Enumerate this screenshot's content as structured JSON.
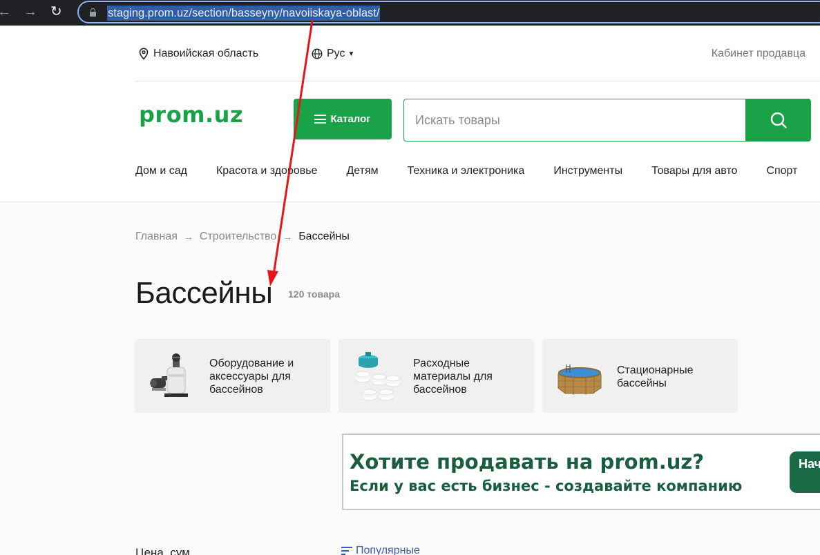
{
  "browser": {
    "back_icon": "←",
    "forward_icon": "→",
    "reload_icon": "↻",
    "url": "staging.prom.uz/section/basseyny/navoiiskaya-oblast/"
  },
  "header": {
    "region": "Навоийская область",
    "language": "Рус",
    "seller_link": "Кабинет продавца",
    "logo": "prom.uz",
    "catalog_button": "Каталог",
    "search_placeholder": "Искать товары",
    "categories": [
      "Дом и сад",
      "Красота и здоровье",
      "Детям",
      "Техника и электроника",
      "Инструменты",
      "Товары для авто",
      "Спорт"
    ]
  },
  "breadcrumb": {
    "home": "Главная",
    "parent": "Строительство",
    "current": "Бассейны",
    "separator": "→"
  },
  "page": {
    "title": "Бассейны",
    "count": "120 товара"
  },
  "subcategories": [
    {
      "label": "Оборудование и аксессуары для бассейнов",
      "icon": "pool-filter-icon"
    },
    {
      "label": "Расходные материалы для бассейнов",
      "icon": "chlorine-tablets-icon"
    },
    {
      "label": "Стационарные бассейны",
      "icon": "octagonal-pool-icon"
    }
  ],
  "banner": {
    "title": "Хотите продавать на prom.uz?",
    "subtitle": "Если у вас есть бизнес - создавайте компанию",
    "button": "Нач"
  },
  "filters": {
    "price_label": "Цена, сум",
    "sort_label": "Популярные"
  },
  "colors": {
    "brand_green": "#1aa249",
    "banner_green": "#1b5e3e",
    "annotation_red": "#e8141a"
  }
}
